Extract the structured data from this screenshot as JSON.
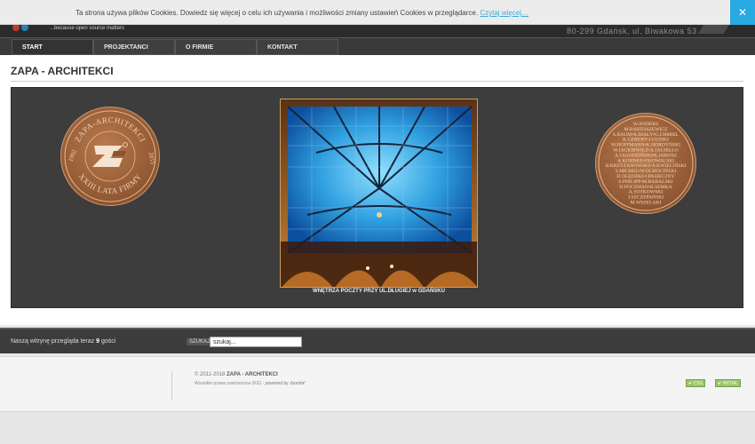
{
  "cookie": {
    "message": "Ta strona używa plików Cookies. Dowiedz się więcej o celu ich używania i możliwości zmiany ustawień Cookies w przeglądarce.",
    "link": "Czytaj więcej…",
    "close": "✕"
  },
  "header": {
    "tagline": "...because open source matters",
    "address": "80-299 Gdańsk, ul. Biwakowa 53"
  },
  "nav": {
    "items": [
      {
        "label": "START"
      },
      {
        "label": "PROJEKTANCI"
      },
      {
        "label": "O FIRMIE"
      },
      {
        "label": "KONTAKT"
      }
    ]
  },
  "main": {
    "title": "ZAPA - ARCHITEKCI",
    "badge_left": {
      "top_text": "ZAPA-ARCHITEKCI",
      "bottom_text": "XXIII LATA FIRMY",
      "year_left": "1992",
      "year_right": "2015"
    },
    "badge_right_names": [
      "W.ANDERS",
      "M.BARTOSZEWICZ",
      "S.BAUM•R.BIAŁY•G.CHMIEL",
      "K.GEBERT•J.GUJSKI",
      "M.HOFFMANN•K.HORDYŃSKI",
      "W.JACKIEWICZ•A.JAGIEŁŁO",
      "A.JAGODZIŃSKI•K.JAROSZ",
      "A.KOHNKE•P.KOWALSKI",
      "B.KRZYŻANOWSKI•A.KWIECIŃSKI",
      "S.MICHEL•W.OCHOCIŃSKI",
      "D.OLĘDZKI•J.PASIECZNY",
      "S.PHILIPP•M.RABALSKI",
      "D.POCZMAN•R.SEMKA",
      "A.SOTKOWSKI",
      "J.SZCZEPAŃSKI",
      "M.WSZELAKI"
    ],
    "photo_caption": "WNĘTRZA POCZTY PRZY UL.DŁUGIEJ w GDAŃSKU"
  },
  "bottom": {
    "visitors_prefix": "Naszą witrynę przegląda teraz ",
    "visitors_count": "9",
    "visitors_suffix": " gości",
    "search_label": "SZUKAJ",
    "search_value": "szukaj..."
  },
  "footer": {
    "copyright": "© 2011-2018",
    "company": "ZAPA - ARCHITEKCI",
    "rights": "Wszelkie prawa zastrzeżone (KG)",
    "powered": "powered by Joomla!",
    "valid_css": "CSS",
    "valid_xhtml": "XHTML"
  },
  "colors": {
    "accent": "#29a9e1",
    "header_bg": "#2b2b2b",
    "panel_bg": "#3d3d3d",
    "badge_copper": "#a86a3f"
  }
}
